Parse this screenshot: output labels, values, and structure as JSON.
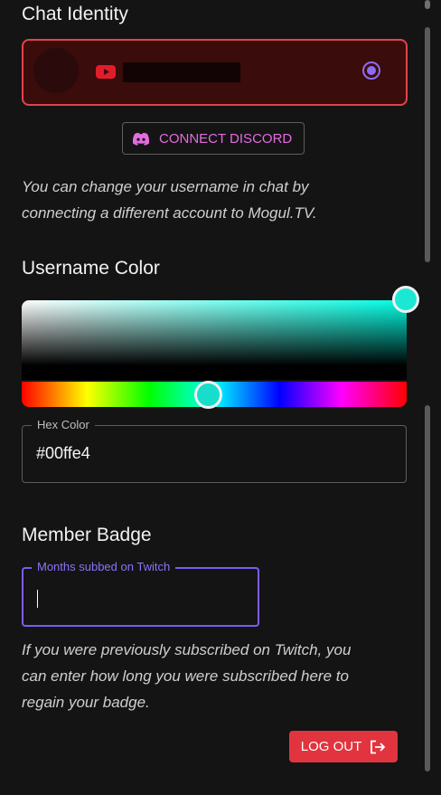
{
  "chat_identity": {
    "heading": "Chat Identity",
    "account_platform_icon": "youtube-icon",
    "account_selected": true
  },
  "discord": {
    "button_label": "CONNECT DISCORD",
    "icon": "discord-icon",
    "color": "#e56be0"
  },
  "identity_help": {
    "line1": "You can change your username in chat by",
    "line2": "connecting a different account to Mogul.TV."
  },
  "username_color": {
    "heading": "Username Color",
    "hex_label": "Hex Color",
    "hex_value": "#00ffe4"
  },
  "member_badge": {
    "heading": "Member Badge",
    "months_label": "Months subbed on Twitch",
    "months_value": "",
    "help_line1": "If you were previously subscribed on Twitch, you",
    "help_line2": "can enter how long you were subscribed here to",
    "help_line3": "regain your badge."
  },
  "logout": {
    "label": "LOG OUT",
    "icon": "logout-icon",
    "color": "#e2343e"
  },
  "accent_colors": {
    "selection_red": "#e2434b",
    "focus_purple": "#7b5df0"
  }
}
